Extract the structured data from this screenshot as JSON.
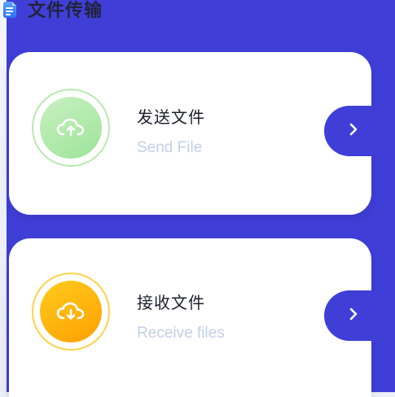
{
  "header": {
    "title": "文件传输",
    "icon": "document-icon"
  },
  "colors": {
    "background": "#3f3fd8",
    "card": "#ffffff",
    "send_accent": "#9ee39a",
    "receive_accent": "#ff9f00",
    "subtitle": "#c3cfe6"
  },
  "send": {
    "title": "发送文件",
    "subtitle": "Send File",
    "icon": "cloud-upload-icon",
    "action_icon": "chevron-right-icon"
  },
  "receive": {
    "title": "接收文件",
    "subtitle": "Receive files",
    "icon": "cloud-download-icon",
    "action_icon": "chevron-right-icon"
  }
}
